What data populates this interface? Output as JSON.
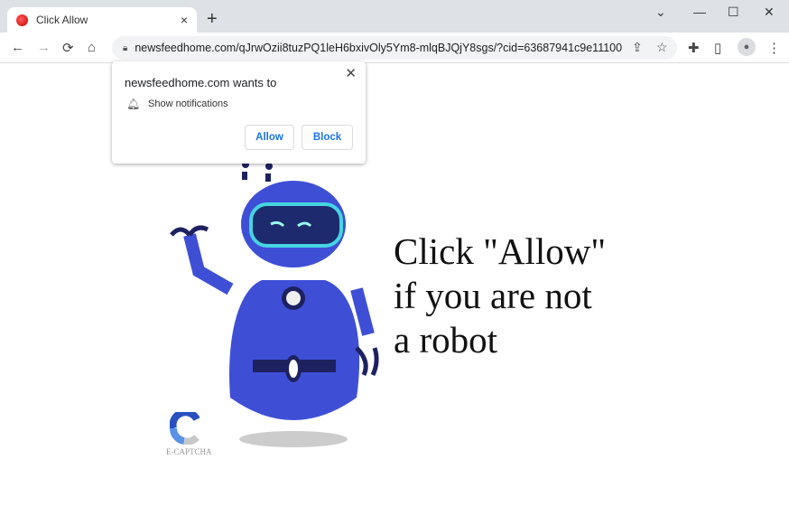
{
  "tab": {
    "title": "Click Allow",
    "close": "×",
    "new_tab": "+"
  },
  "window": {
    "dropdown": "⌄",
    "minimize": "—",
    "maximize": "☐",
    "close": "✕"
  },
  "toolbar": {
    "back": "←",
    "forward": "→",
    "reload": "⟳",
    "home": "⌂",
    "url": "newsfeedhome.com/qJrwOzii8tuzPQ1leH6bxivOly5Ym8-mlqBJQjY8sgs/?cid=63687941c9e111000...",
    "share": "⇪",
    "star": "☆",
    "extensions": "✚",
    "sidepanel": "▯",
    "profile": "●",
    "menu": "⋮"
  },
  "popup": {
    "title": "newsfeedhome.com wants to",
    "permission": "Show notifications",
    "allow": "Allow",
    "block": "Block",
    "close": "✕"
  },
  "page": {
    "headline_lines": [
      "Click \"Allow\"",
      "if you are not",
      "a robot"
    ],
    "logo_text": "E-CAPTCHA"
  },
  "colors": {
    "robot_blue": "#3e4fd6",
    "accent": "#1a73e8"
  }
}
